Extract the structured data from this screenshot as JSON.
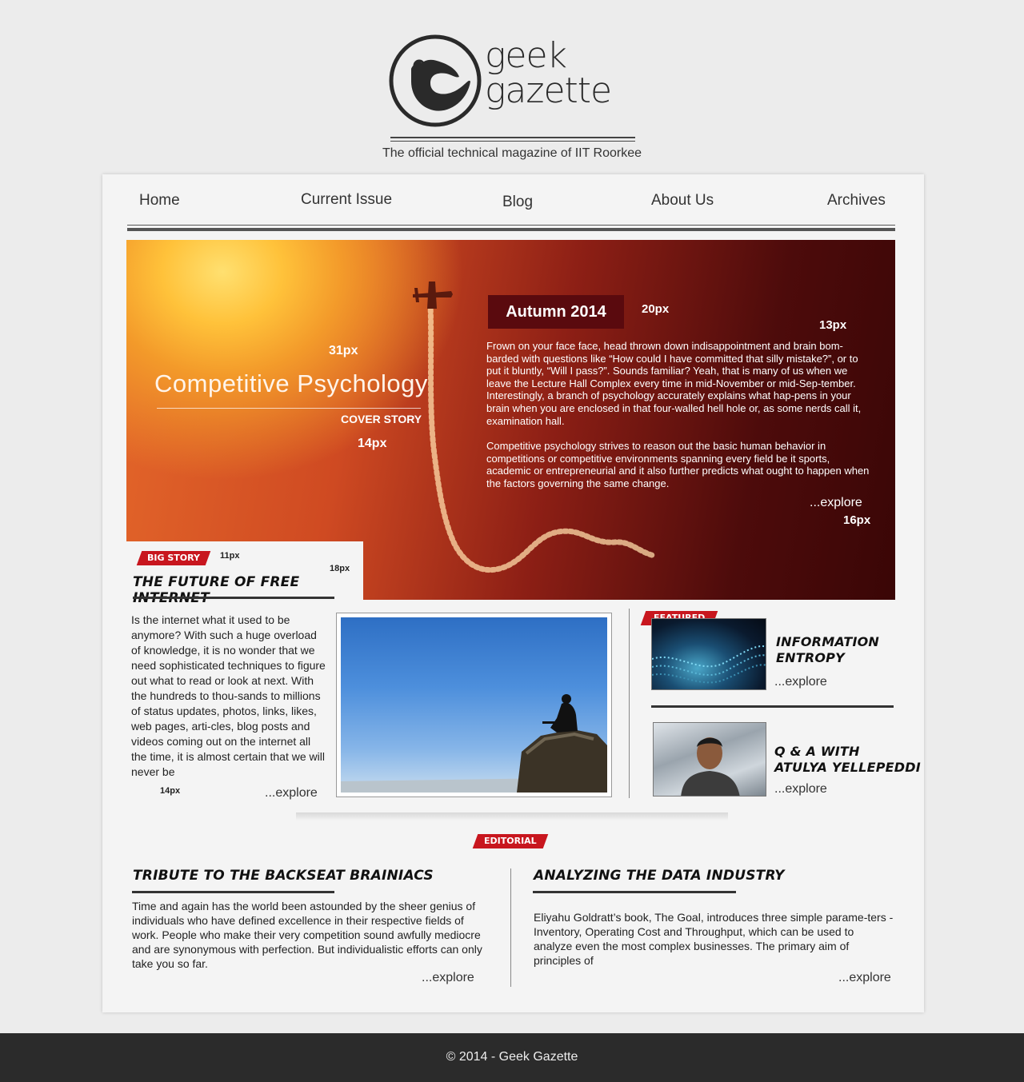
{
  "header": {
    "logo_line1": "geek",
    "logo_line2": "gazette",
    "tagline": "The official technical magazine of IIT Roorkee"
  },
  "nav": {
    "items": [
      {
        "label": "Home"
      },
      {
        "label": "Current Issue"
      },
      {
        "label": "Blog"
      },
      {
        "label": "About Us"
      },
      {
        "label": "Archives"
      }
    ]
  },
  "hero": {
    "title": "Competitive Psychology",
    "cover_label": "COVER STORY",
    "season": "Autumn 2014",
    "paragraph1": "Frown on your face face, head thrown down indisappointment and brain bom-barded with questions like “How could I have committed that silly mistake?”, or to put it bluntly, “Will I pass?”. Sounds familiar? Yeah, that is many of us when we leave the Lecture Hall Complex every time in mid-November or mid-Sep-tember. Interestingly, a branch of psychology accurately explains what hap-pens in your brain when you are enclosed in that four-walled hell hole or, as some nerds call it, examination hall.",
    "paragraph2": "Competitive psychology strives to reason out the basic human behavior in competitions or competitive environments spanning every field be it sports, academic or entrepreneurial and it also further predicts what ought to happen when the factors governing the same change.",
    "explore": "...explore",
    "annotations": {
      "title_size": "31px",
      "label_size": "14px",
      "season_size": "20px",
      "body_size": "13px",
      "explore_size": "16px"
    }
  },
  "big_story": {
    "tag": "BIG STORY",
    "tag_size": "11px",
    "heading_size": "18px",
    "heading": "THE FUTURE OF FREE INTERNET",
    "text": "Is the internet what it used to be anymore? With such a huge overload of  knowledge, it is no wonder that we need sophisticated techniques to figure out what to read or look at next. With the hundreds to thou-sands to millions of status updates, photos, links, likes, web pages, arti-cles, blog posts and videos coming out on the internet all the time, it is almost certain that we will never be",
    "text_size": "14px",
    "explore": "...explore"
  },
  "featured": {
    "tag": "FEATURED",
    "items": [
      {
        "title_line1": "INFORMATION",
        "title_line2": "ENTROPY",
        "explore": "...explore"
      },
      {
        "title_line1": "Q & A WITH",
        "title_line2": "ATULYA YELLEPEDDI",
        "explore": "...explore"
      }
    ]
  },
  "editorial": {
    "tag": "EDITORIAL",
    "articles": [
      {
        "heading": "TRIBUTE TO THE BACKSEAT BRAINIACS",
        "text": "Time and again has the world been astounded by the sheer genius of individuals who have defined excellence in their respective fields of work. People who make their very competition sound awfully mediocre and are synonymous with perfection. But individualistic efforts can only take you so far.",
        "explore": "...explore"
      },
      {
        "heading": "ANALYZING THE DATA INDUSTRY",
        "text": "Eliyahu Goldratt’s book, The Goal, introduces three simple parame-ters - Inventory, Operating Cost and Throughput, which can be used to analyze even the most complex businesses. The primary aim of principles of",
        "explore": "...explore"
      }
    ]
  },
  "footer": {
    "text": "© 2014  -  Geek Gazette"
  },
  "colors": {
    "accent": "#c8161e",
    "dark": "#2b2b2b",
    "season_bg": "#5a0a0e"
  }
}
